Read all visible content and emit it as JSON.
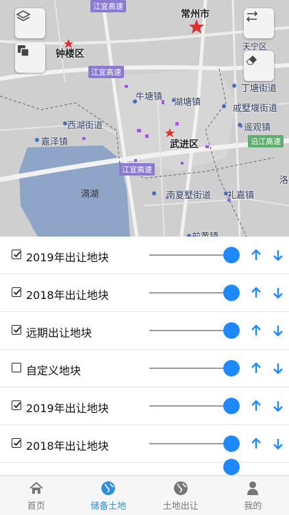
{
  "map": {
    "places": {
      "changzhou": "常州市",
      "zhonglou": "钟楼区",
      "tianning": "天宁区",
      "jiangyi_top": "江宜高速",
      "jiangyi_mid": "江宜高速",
      "jiangyi_low": "江宜高速",
      "niutang": "牛塘镇",
      "hutang": "湖塘镇",
      "dingtang": "丁塘街道",
      "qishuyan": "戚墅堰街道",
      "yaoguan": "遥观镇",
      "xihu": "西湖街道",
      "jiaze": "嘉泽镇",
      "wujin": "武进区",
      "yanjiang": "沿江高速",
      "lake": "滆湖",
      "nanxiashu": "南夏墅街道",
      "lihe": "礼嘉镇",
      "luo": "洛",
      "qianhuang": "前黄镇"
    },
    "buttons": [
      "layers-icon",
      "copy-icon",
      "swap-icon",
      "eraser-icon"
    ]
  },
  "layers": [
    {
      "label": "2019年出让地块",
      "checked": true,
      "opacity": 1.0
    },
    {
      "label": "2018年出让地块",
      "checked": true,
      "opacity": 1.0
    },
    {
      "label": "远期出让地块",
      "checked": true,
      "opacity": 1.0
    },
    {
      "label": "自定义地块",
      "checked": false,
      "opacity": 1.0
    },
    {
      "label": "2019年出让地块",
      "checked": true,
      "opacity": 1.0
    },
    {
      "label": "2018年出让地块",
      "checked": true,
      "opacity": 1.0
    }
  ],
  "tabs": [
    {
      "label": "首页",
      "icon": "home-icon",
      "active": false
    },
    {
      "label": "储备土地",
      "icon": "globe-icon",
      "active": true
    },
    {
      "label": "土地出让",
      "icon": "globe-icon",
      "active": false
    },
    {
      "label": "我的",
      "icon": "user-icon",
      "active": false
    }
  ],
  "colors": {
    "accent": "#1e88ff",
    "tab_active": "#2f8fd8",
    "tab_inactive": "#777777",
    "map_bg": "#cfcfcf",
    "lake": "#8fa5c8",
    "road_badge": "#8a7bd1"
  }
}
